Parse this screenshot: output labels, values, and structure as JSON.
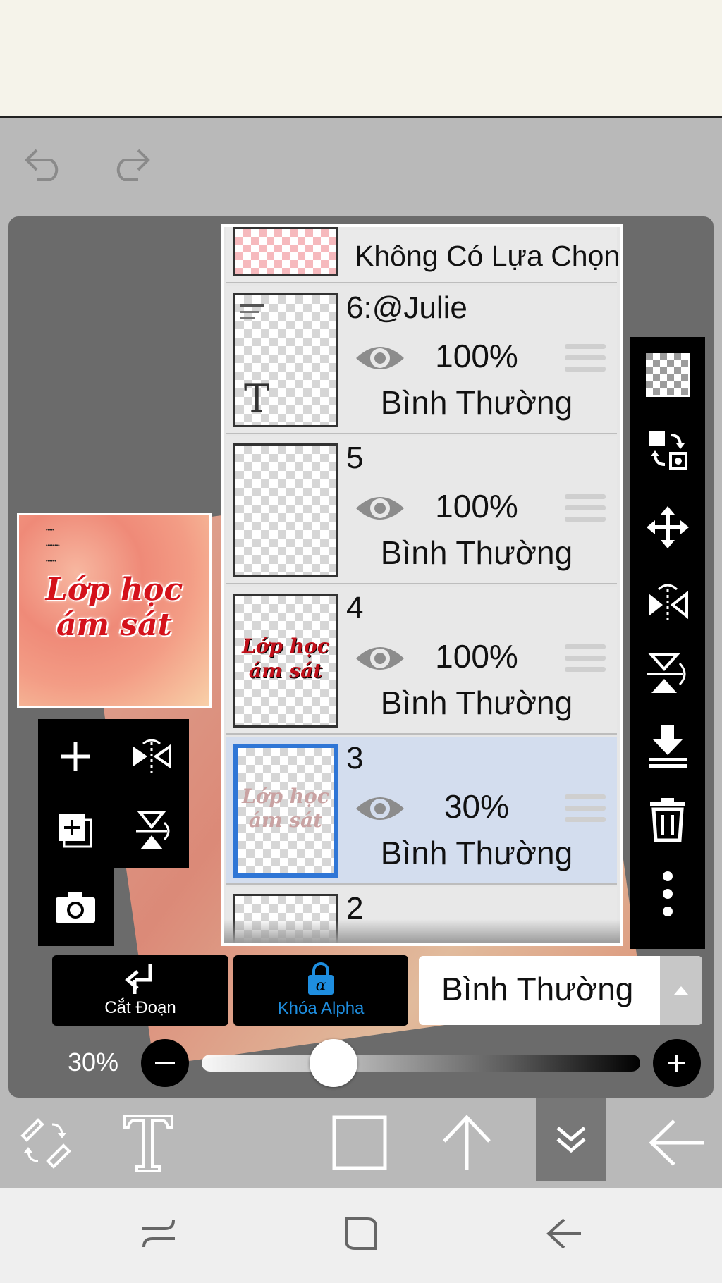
{
  "toolbar": {
    "undo_icon": "undo-icon",
    "redo_icon": "redo-icon"
  },
  "preview": {
    "title_line1": "Lớp học",
    "title_line2": "ám sát"
  },
  "layer_panel": {
    "no_selection_label": "Không Có Lựa Chọn",
    "layers": [
      {
        "name": "6:@Julie",
        "opacity": "100%",
        "blend": "Bình Thường",
        "visible": true,
        "selected": false
      },
      {
        "name": "5",
        "opacity": "100%",
        "blend": "Bình Thường",
        "visible": true,
        "selected": false
      },
      {
        "name": "4",
        "opacity": "100%",
        "blend": "Bình Thường",
        "visible": true,
        "selected": false
      },
      {
        "name": "3",
        "opacity": "30%",
        "blend": "Bình Thường",
        "visible": true,
        "selected": true
      },
      {
        "name": "2"
      }
    ]
  },
  "actions": {
    "clip_label": "Cắt Đoạn",
    "alpha_lock_label": "Khóa Alpha",
    "alpha_lock_color": "#1e8ee0",
    "blend_mode_value": "Bình Thường"
  },
  "opacity_slider": {
    "label": "30%",
    "value": 0.3
  },
  "colors": {
    "accent_blue": "#2f76d6",
    "selected_row": "#d3ddee",
    "panel_bg": "#6b6b6b"
  }
}
